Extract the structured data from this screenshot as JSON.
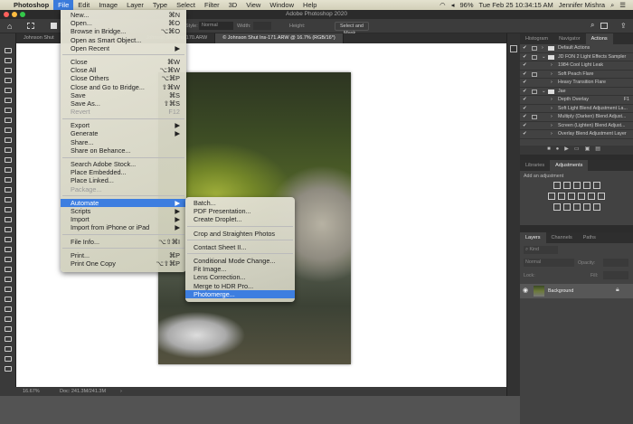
{
  "menubar": {
    "apple": "",
    "items": [
      "Photoshop",
      "File",
      "Edit",
      "Image",
      "Layer",
      "Type",
      "Select",
      "Filter",
      "3D",
      "View",
      "Window",
      "Help"
    ],
    "active": "File",
    "battery": "96%",
    "datetime": "Tue Feb 25  10:34:15 AM",
    "user": "Jennifer Mishra"
  },
  "titlebar": {
    "title": "Adobe Photoshop 2020"
  },
  "options": {
    "style_label": "Style:",
    "style_value": "Normal",
    "width_label": "Width:",
    "height_label": "Height:",
    "select_mask": "Select and Mask..."
  },
  "tabs": [
    "Johnson Shut",
    "Johnson Shut Ins-169.ARW",
    "Johnson Shut Ins-170.ARW",
    "© Johnson Shut Ins-171.ARW @ 16.7% (RGB/16*)"
  ],
  "file_menu": [
    [
      {
        "label": "New...",
        "key": "⌘N"
      },
      {
        "label": "Open...",
        "key": "⌘O"
      },
      {
        "label": "Browse in Bridge...",
        "key": "⌥⌘O"
      },
      {
        "label": "Open as Smart Object...",
        "key": ""
      },
      {
        "label": "Open Recent",
        "key": "▶"
      }
    ],
    [
      {
        "label": "Close",
        "key": "⌘W"
      },
      {
        "label": "Close All",
        "key": "⌥⌘W"
      },
      {
        "label": "Close Others",
        "key": "⌥⌘P"
      },
      {
        "label": "Close and Go to Bridge...",
        "key": "⇧⌘W"
      },
      {
        "label": "Save",
        "key": "⌘S"
      },
      {
        "label": "Save As...",
        "key": "⇧⌘S"
      },
      {
        "label": "Revert",
        "key": "F12",
        "disabled": true
      }
    ],
    [
      {
        "label": "Export",
        "key": "▶"
      },
      {
        "label": "Generate",
        "key": "▶"
      },
      {
        "label": "Share...",
        "key": ""
      },
      {
        "label": "Share on Behance...",
        "key": ""
      }
    ],
    [
      {
        "label": "Search Adobe Stock...",
        "key": ""
      },
      {
        "label": "Place Embedded...",
        "key": ""
      },
      {
        "label": "Place Linked...",
        "key": ""
      },
      {
        "label": "Package...",
        "key": "",
        "disabled": true
      }
    ],
    [
      {
        "label": "Automate",
        "key": "▶",
        "highlighted": true
      },
      {
        "label": "Scripts",
        "key": "▶"
      },
      {
        "label": "Import",
        "key": "▶"
      },
      {
        "label": "Import from iPhone or iPad",
        "key": "▶"
      }
    ],
    [
      {
        "label": "File Info...",
        "key": "⌥⇧⌘I"
      }
    ],
    [
      {
        "label": "Print...",
        "key": "⌘P"
      },
      {
        "label": "Print One Copy",
        "key": "⌥⇧⌘P"
      }
    ]
  ],
  "automate_menu": [
    [
      "Batch...",
      "PDF Presentation...",
      "Create Droplet..."
    ],
    [
      "Crop and Straighten Photos"
    ],
    [
      "Contact Sheet II..."
    ],
    [
      "Conditional Mode Change...",
      "Fit Image...",
      "Lens Correction...",
      "Merge to HDR Pro...",
      "Photomerge..."
    ]
  ],
  "automate_highlighted": "Photomerge...",
  "actions_panel": {
    "tabs": [
      "Histogram",
      "Navigator",
      "Actions"
    ],
    "active": "Actions",
    "rows": [
      {
        "label": "Default Actions",
        "level": 0,
        "folder": true,
        "dialog": true
      },
      {
        "label": "JD FON 2 Light Effects Sampler",
        "level": 0,
        "folder": true,
        "open": true,
        "dialog": true
      },
      {
        "label": "1984 Cool Light Leak",
        "level": 1
      },
      {
        "label": "Soft Peach Flare",
        "level": 1,
        "dialog": true
      },
      {
        "label": "Heavy Transition Flare",
        "level": 1
      },
      {
        "label": "Jae",
        "level": 0,
        "folder": true,
        "open": true,
        "dialog": true
      },
      {
        "label": "Depth Overlay",
        "level": 1,
        "key": "F1"
      },
      {
        "label": "Soft Light Blend Adjustment La...",
        "level": 1
      },
      {
        "label": "Multiply (Darken) Blend Adjust...",
        "level": 1,
        "dialog": true
      },
      {
        "label": "Screen (Lighten) Blend Adjust...",
        "level": 1
      },
      {
        "label": "Overlay Blend Adjustment Layer",
        "level": 1
      }
    ]
  },
  "adjustments_panel": {
    "tabs": [
      "Libraries",
      "Adjustments"
    ],
    "active": "Adjustments",
    "hint": "Add an adjustment"
  },
  "layers_panel": {
    "tabs": [
      "Layers",
      "Channels",
      "Paths"
    ],
    "active": "Layers",
    "filter": "Kind",
    "blend": "Normal",
    "opacity_label": "Opacity:",
    "lock_label": "Lock:",
    "fill_label": "Fill:",
    "layers": [
      {
        "name": "Background",
        "visible": true,
        "locked": true
      }
    ]
  },
  "status": {
    "zoom": "16.67%",
    "doc": "Doc: 241.3M/241.3M"
  }
}
